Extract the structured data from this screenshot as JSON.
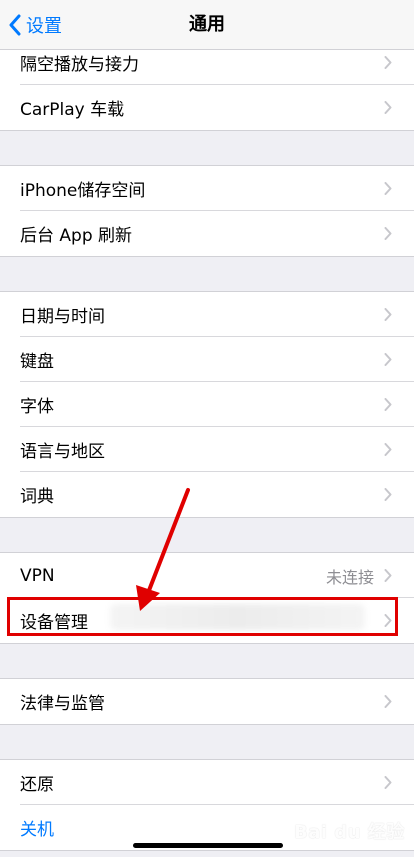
{
  "navbar": {
    "back_label": "设置",
    "title": "通用"
  },
  "groups": [
    {
      "items": [
        {
          "label": "隔空播放与接力"
        },
        {
          "label": "CarPlay 车载"
        }
      ]
    },
    {
      "items": [
        {
          "label": "iPhone储存空间"
        },
        {
          "label": "后台 App 刷新"
        }
      ]
    },
    {
      "items": [
        {
          "label": "日期与时间"
        },
        {
          "label": "键盘"
        },
        {
          "label": "字体"
        },
        {
          "label": "语言与地区"
        },
        {
          "label": "词典"
        }
      ]
    },
    {
      "items": [
        {
          "label": "VPN",
          "value": "未连接"
        },
        {
          "label": "设备管理"
        }
      ]
    },
    {
      "items": [
        {
          "label": "法律与监管"
        }
      ]
    },
    {
      "items": [
        {
          "label": "还原"
        },
        {
          "label": "关机"
        }
      ]
    }
  ],
  "colors": {
    "accent": "#007aff",
    "annotation": "#e00000"
  },
  "watermark": {
    "text": "Bai du 经验"
  }
}
